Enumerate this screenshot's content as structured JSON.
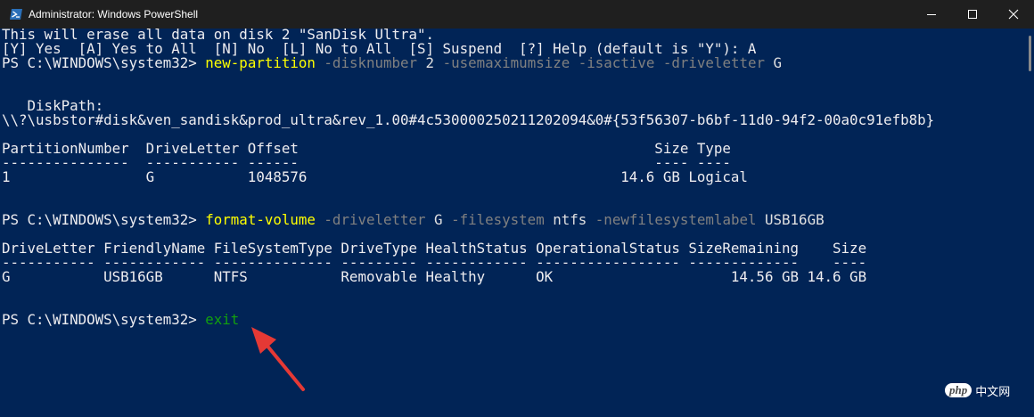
{
  "window": {
    "title": "Administrator: Windows PowerShell",
    "app_icon": "powershell-icon",
    "controls": [
      "minimize-icon",
      "maximize-icon",
      "close-icon"
    ]
  },
  "terminal": {
    "lines": [
      {
        "kind": "text",
        "text": "This will erase all data on disk 2 \"SanDisk Ultra\"."
      },
      {
        "kind": "text",
        "text": "[Y] Yes  [A] Yes to All  [N] No  [L] No to All  [S] Suspend  [?] Help (default is \"Y\"): A"
      },
      {
        "kind": "prompt",
        "prompt": "PS C:\\WINDOWS\\system32> ",
        "command": "new-partition",
        "args": [
          {
            "t": " -disknumber",
            "k": "param"
          },
          {
            "t": " 2",
            "k": "arg"
          },
          {
            "t": " -usemaximumsize",
            "k": "param"
          },
          {
            "t": " -isactive",
            "k": "param"
          },
          {
            "t": " -driveletter",
            "k": "param"
          },
          {
            "t": " G",
            "k": "arg"
          }
        ]
      },
      {
        "kind": "blank"
      },
      {
        "kind": "blank"
      },
      {
        "kind": "text",
        "text": "   DiskPath:"
      },
      {
        "kind": "text",
        "text": "\\\\?\\usbstor#disk&ven_sandisk&prod_ultra&rev_1.00#4c530000250211202094&0#{53f56307-b6bf-11d0-94f2-00a0c91efb8b}"
      },
      {
        "kind": "blank"
      },
      {
        "kind": "text",
        "text": "PartitionNumber  DriveLetter Offset                                          Size Type"
      },
      {
        "kind": "text",
        "text": "---------------  ----------- ------                                          ---- ----"
      },
      {
        "kind": "text",
        "text": "1                G           1048576                                     14.6 GB Logical"
      },
      {
        "kind": "blank"
      },
      {
        "kind": "blank"
      },
      {
        "kind": "prompt",
        "prompt": "PS C:\\WINDOWS\\system32> ",
        "command": "format-volume",
        "args": [
          {
            "t": " -driveletter",
            "k": "param"
          },
          {
            "t": " G",
            "k": "arg"
          },
          {
            "t": " -filesystem",
            "k": "param"
          },
          {
            "t": " ntfs",
            "k": "arg"
          },
          {
            "t": " -newfilesystemlabel",
            "k": "param"
          },
          {
            "t": " USB16GB",
            "k": "arg"
          }
        ]
      },
      {
        "kind": "blank"
      },
      {
        "kind": "text",
        "text": "DriveLetter FriendlyName FileSystemType DriveType HealthStatus OperationalStatus SizeRemaining    Size"
      },
      {
        "kind": "text",
        "text": "----------- ------------ -------------- --------- ------------ ----------------- -------------    ----"
      },
      {
        "kind": "text",
        "text": "G           USB16GB      NTFS           Removable Healthy      OK                     14.56 GB 14.6 GB"
      },
      {
        "kind": "blank"
      },
      {
        "kind": "blank"
      },
      {
        "kind": "prompt",
        "prompt": "PS C:\\WINDOWS\\system32> ",
        "command": "exit",
        "exit": true,
        "args": []
      }
    ]
  },
  "annotation": {
    "arrow_color": "#e53935",
    "points_to": "exit"
  },
  "watermark": {
    "logo": "php",
    "text": "中文网"
  },
  "colors": {
    "background": "#012456",
    "titlebar": "#1f1f1f",
    "command": "#ffff00",
    "parameter": "#808080",
    "exit_command": "#13a10e"
  }
}
